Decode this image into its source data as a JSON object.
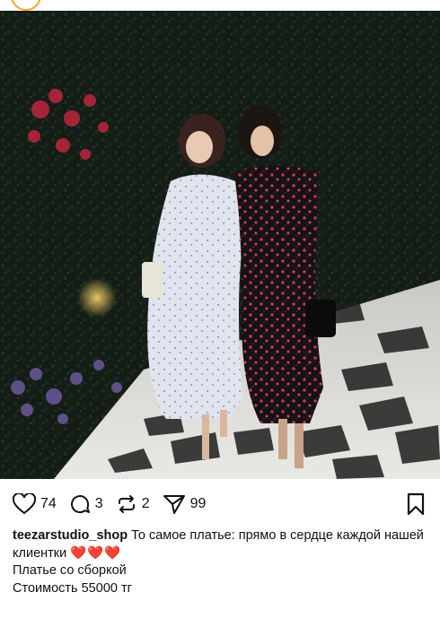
{
  "post": {
    "likes": "74",
    "comments": "3",
    "reposts": "2",
    "shares": "99"
  },
  "caption": {
    "username": "teezarstudio_shop",
    "text": "То самое платье: прямо в сердце каждой нашей клиентки",
    "hearts": "❤️❤️❤️",
    "line2": "Платье со сборкой",
    "line3": "Стоимость 55000 тг"
  },
  "colors": {
    "heart": "#e0282e",
    "avatar_ring": "#f5a623"
  },
  "icons": [
    "heart-icon",
    "comment-icon",
    "repost-icon",
    "share-icon",
    "bookmark-icon"
  ]
}
